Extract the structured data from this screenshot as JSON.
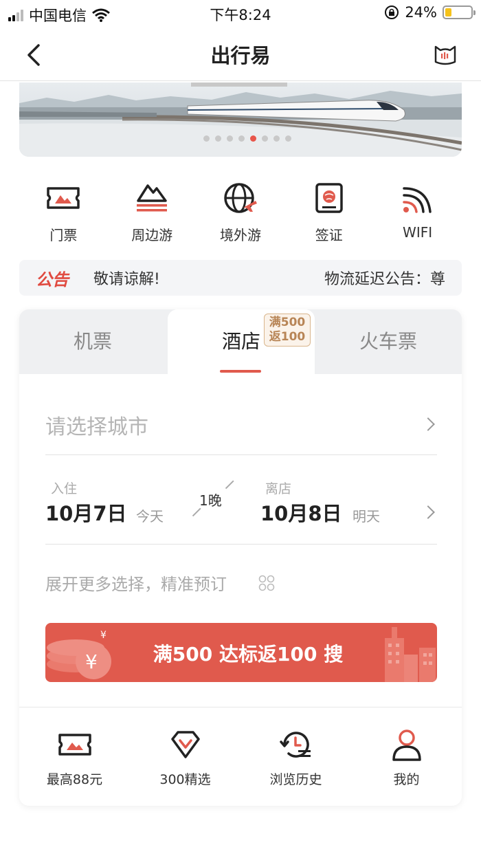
{
  "status_bar": {
    "carrier": "中国电信",
    "time": "下午8:24",
    "battery_pct": "24%",
    "battery_level": 0.24,
    "battery_color": "#f5c21b"
  },
  "nav": {
    "title": "出行易",
    "back_icon": "chevron-left-icon",
    "right_icon": "cat-mascot-icon"
  },
  "banner": {
    "slide_count": 8,
    "active_slide": 5
  },
  "categories": [
    {
      "label": "门票",
      "icon": "ticket-icon"
    },
    {
      "label": "周边游",
      "icon": "mountain-icon"
    },
    {
      "label": "境外游",
      "icon": "globe-plane-icon"
    },
    {
      "label": "签证",
      "icon": "passport-icon"
    },
    {
      "label": "WIFI",
      "icon": "wifi-icon"
    }
  ],
  "notice": {
    "tag": "公告",
    "text1": "敬请谅解!",
    "text2": "物流延迟公告：尊"
  },
  "booking": {
    "tabs": [
      {
        "label": "机票"
      },
      {
        "label": "酒店"
      },
      {
        "label": "火车票"
      }
    ],
    "active_tab": 1,
    "promo_badge": {
      "line1": "满500",
      "line2": "返100"
    },
    "city_placeholder": "请选择城市",
    "checkin": {
      "label": "入住",
      "date": "10月7日",
      "day": "今天"
    },
    "nights": "1晚",
    "checkout": {
      "label": "离店",
      "date": "10月8日",
      "day": "明天"
    },
    "more_options": "展开更多选择，精准预订",
    "search_button": "满500 达标返100 搜",
    "accent": "#e05a4d"
  },
  "bottom_links": [
    {
      "label": "最高88元",
      "icon": "ticket-icon"
    },
    {
      "label": "300精选",
      "icon": "diamond-icon"
    },
    {
      "label": "浏览历史",
      "icon": "history-icon"
    },
    {
      "label": "我的",
      "icon": "user-icon"
    }
  ]
}
